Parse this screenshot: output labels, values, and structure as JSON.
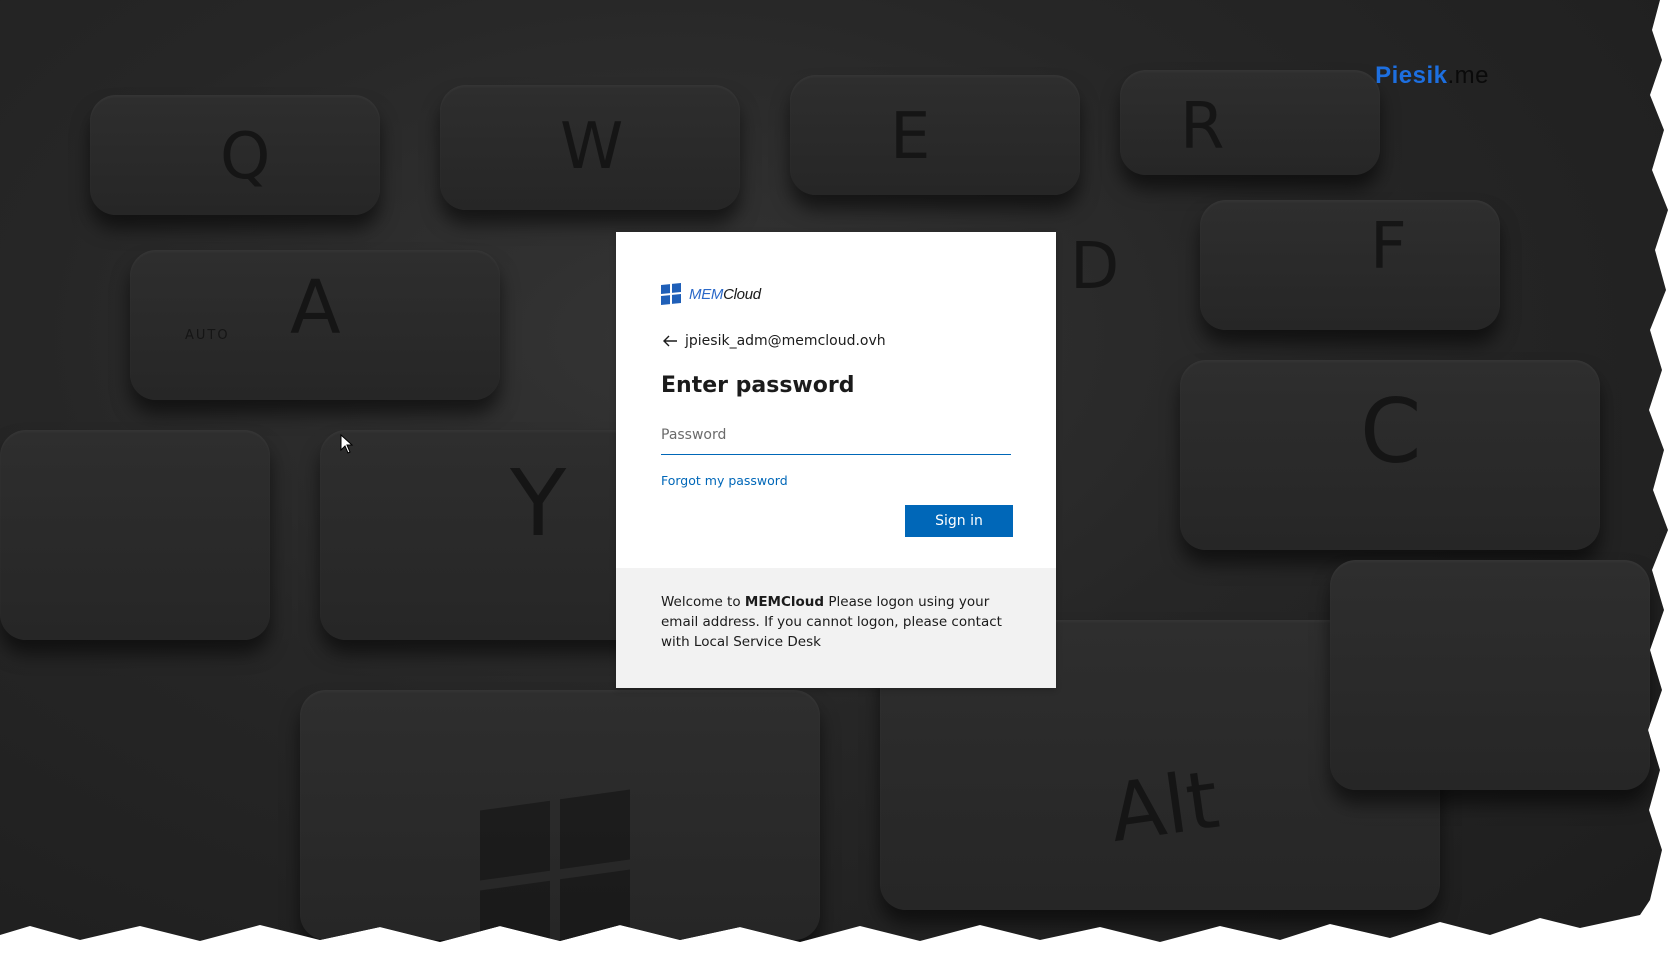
{
  "watermark": {
    "brand": "Piesik",
    "suffix": ".me"
  },
  "signin": {
    "logo": {
      "prefix": "MEM",
      "name": "Cloud"
    },
    "account": "jpiesik_adm@memcloud.ovh",
    "title": "Enter password",
    "password_placeholder": "Password",
    "forgot_link": "Forgot my password",
    "signin_button": "Sign in"
  },
  "footer": {
    "welcome_prefix": "Welcome to ",
    "welcome_brand": "MEMCloud",
    "welcome_rest": " Please logon using your email address. If you cannot logon, please contact with Local Service Desk"
  },
  "backdrop_keys": [
    "Q",
    "W",
    "E",
    "R",
    "A",
    "D",
    "F",
    "Y",
    "C",
    "Alt",
    "AUTO"
  ],
  "colors": {
    "accent": "#0067b8",
    "footer_bg": "#f2f2f2",
    "brand_blue": "#1d6fe0"
  }
}
